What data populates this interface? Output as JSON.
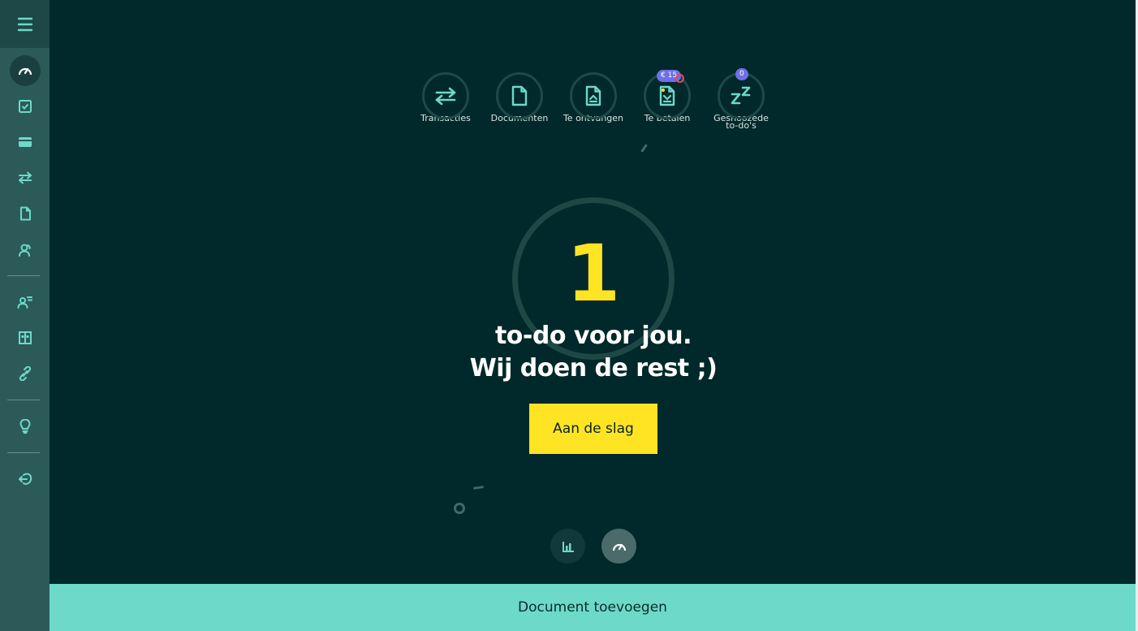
{
  "sidebar": {
    "menu_icon": "hamburger-icon",
    "items": [
      {
        "name": "dashboard",
        "icon": "speedometer-icon",
        "active": true
      },
      {
        "name": "todos",
        "icon": "checkbox-icon",
        "active": false
      },
      {
        "name": "cards",
        "icon": "credit-card-icon",
        "active": false
      },
      {
        "name": "transactions",
        "icon": "arrows-swap-icon",
        "active": false
      },
      {
        "name": "documents",
        "icon": "document-icon",
        "active": false
      },
      {
        "name": "contacts",
        "icon": "people-icon",
        "active": false
      },
      {
        "name": "users",
        "icon": "user-list-icon",
        "active": false
      },
      {
        "name": "store",
        "icon": "store-icon",
        "active": false
      },
      {
        "name": "links",
        "icon": "link-icon",
        "active": false
      },
      {
        "name": "tips",
        "icon": "lightbulb-icon",
        "active": false
      },
      {
        "name": "logout",
        "icon": "logout-icon",
        "active": false
      }
    ]
  },
  "top_nav": [
    {
      "label": "Transacties",
      "icon": "arrows-swap-icon"
    },
    {
      "label": "Documenten",
      "icon": "document-icon"
    },
    {
      "label": "Te ontvangen",
      "icon": "receive-document-icon"
    },
    {
      "label": "Te betalen",
      "icon": "pay-document-icon",
      "badge": "€ 15"
    },
    {
      "label": "Gesnoozede\nto-do's",
      "icon": "snooze-icon",
      "badge": "0"
    }
  ],
  "main": {
    "count": "1",
    "headline_line1": "to-do voor jou.",
    "headline_line2": "Wij doen de rest ;)",
    "cta_label": "Aan de slag"
  },
  "footer": {
    "label": "Document toevoegen"
  },
  "colors": {
    "background": "#01282a",
    "sidebar": "#2b5a59",
    "accent_yellow": "#ffe423",
    "accent_teal": "#6dd9c9",
    "badge": "#6f6fe6"
  }
}
